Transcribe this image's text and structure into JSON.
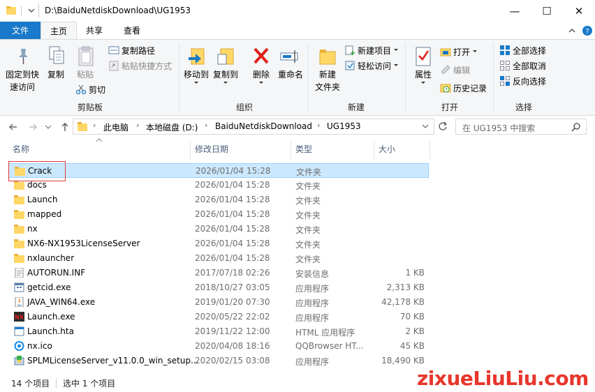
{
  "window": {
    "title": "D:\\BaiduNetdiskDownload\\UG1953",
    "minimize_glyph": "—",
    "maximize_glyph": "☐",
    "close_glyph": "✕"
  },
  "tabs": {
    "file": "文件",
    "home": "主页",
    "share": "共享",
    "view": "查看"
  },
  "ribbon": {
    "clipboard": {
      "pin": "固定到快\n速访问",
      "copy": "复制",
      "paste": "粘贴",
      "copy_path": "复制路径",
      "paste_shortcut": "粘贴快捷方式",
      "cut": "剪切",
      "label": "剪贴板"
    },
    "organize": {
      "move_to": "移动到",
      "copy_to": "复制到",
      "delete": "删除",
      "rename": "重命名",
      "label": "组织"
    },
    "new": {
      "new_folder": "新建\n文件夹",
      "new_item": "新建项目",
      "easy_access": "轻松访问",
      "label": "新建"
    },
    "open": {
      "properties": "属性",
      "open": "打开",
      "edit": "编辑",
      "history": "历史记录",
      "label": "打开"
    },
    "select": {
      "select_all": "全部选择",
      "select_none": "全部取消",
      "invert": "反向选择",
      "label": "选择"
    }
  },
  "address": {
    "crumbs": [
      "此电脑",
      "本地磁盘 (D:)",
      "BaiduNetdiskDownload",
      "UG1953"
    ],
    "search_placeholder": "在 UG1953 中搜索"
  },
  "columns": {
    "name": "名称",
    "date": "修改日期",
    "type": "类型",
    "size": "大小"
  },
  "files": [
    {
      "name": "Crack",
      "date": "2026/01/04 15:28",
      "type": "文件夹",
      "size": "",
      "icon": "folder-icon",
      "selected": true
    },
    {
      "name": "docs",
      "date": "2026/01/04 15:28",
      "type": "文件夹",
      "size": "",
      "icon": "folder-icon"
    },
    {
      "name": "Launch",
      "date": "2026/01/04 15:28",
      "type": "文件夹",
      "size": "",
      "icon": "folder-icon"
    },
    {
      "name": "mapped",
      "date": "2026/01/04 15:28",
      "type": "文件夹",
      "size": "",
      "icon": "folder-icon"
    },
    {
      "name": "nx",
      "date": "2026/01/04 15:28",
      "type": "文件夹",
      "size": "",
      "icon": "folder-icon"
    },
    {
      "name": "NX6-NX1953LicenseServer",
      "date": "2026/01/04 15:28",
      "type": "文件夹",
      "size": "",
      "icon": "folder-icon"
    },
    {
      "name": "nxlauncher",
      "date": "2026/01/04 15:28",
      "type": "文件夹",
      "size": "",
      "icon": "folder-icon"
    },
    {
      "name": "AUTORUN.INF",
      "date": "2017/07/18 02:26",
      "type": "安装信息",
      "size": "1 KB",
      "icon": "inf-file-icon"
    },
    {
      "name": "getcid.exe",
      "date": "2018/10/27 03:05",
      "type": "应用程序",
      "size": "2,313 KB",
      "icon": "exe-icon"
    },
    {
      "name": "JAVA_WIN64.exe",
      "date": "2019/01/20 07:30",
      "type": "应用程序",
      "size": "42,178 KB",
      "icon": "java-icon"
    },
    {
      "name": "Launch.exe",
      "date": "2020/05/22 22:02",
      "type": "应用程序",
      "size": "70 KB",
      "icon": "nx-app-icon"
    },
    {
      "name": "Launch.hta",
      "date": "2019/11/22 12:00",
      "type": "HTML 应用程序",
      "size": "2 KB",
      "icon": "hta-icon"
    },
    {
      "name": "nx.ico",
      "date": "2020/04/08 18:16",
      "type": "QQBrowser HT...",
      "size": "45 KB",
      "icon": "qqbrowser-icon"
    },
    {
      "name": "SPLMLicenseServer_v11.0.0_win_setup...",
      "date": "2020/02/15 03:08",
      "type": "应用程序",
      "size": "18,490 KB",
      "icon": "installer-icon"
    }
  ],
  "status": {
    "count": "14 个项目",
    "selected": "选中 1 个项目"
  },
  "watermark": "zixueLiuLiu.com",
  "colors": {
    "accent": "#1979ca",
    "selection": "#cce8ff",
    "highlight_box": "#e03a3a"
  }
}
